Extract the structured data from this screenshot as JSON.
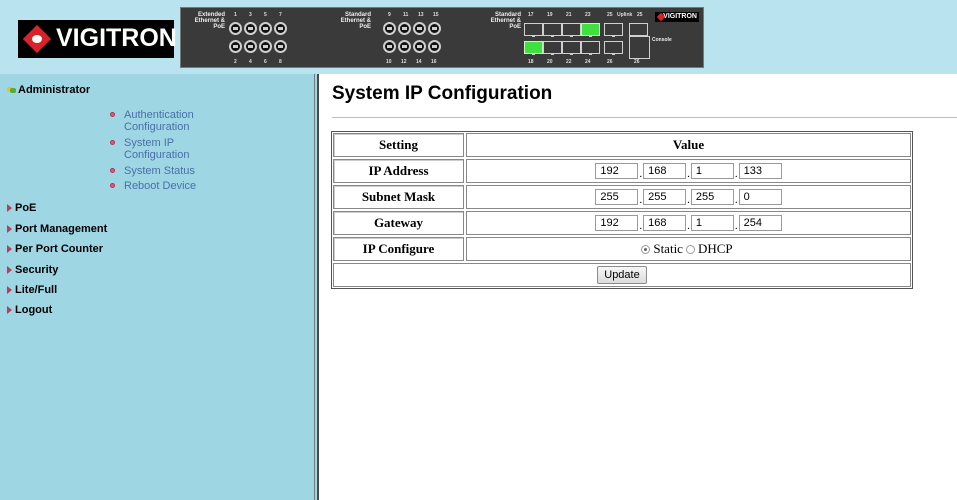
{
  "brand": {
    "logo_text": "VIGITRON",
    "mini_logo_text": "VIGITRON"
  },
  "device": {
    "groups": [
      {
        "label": "Extended Ethernet & PoE",
        "top_ports": [
          "1",
          "3",
          "5",
          "7"
        ],
        "bottom_ports": [
          "2",
          "4",
          "6",
          "8"
        ]
      },
      {
        "label": "Standard Ethernet & PoE",
        "top_ports": [
          "9",
          "11",
          "13",
          "15"
        ],
        "bottom_ports": [
          "10",
          "12",
          "14",
          "16"
        ]
      },
      {
        "label": "Standard Ethernet & PoE",
        "top_ports": [
          "17",
          "19",
          "21",
          "23"
        ],
        "bottom_ports": [
          "18",
          "20",
          "22",
          "24"
        ]
      }
    ],
    "uplink_label": "Uplink",
    "uplink_top": [
      "25",
      "25"
    ],
    "uplink_bottom": [
      "26",
      "26"
    ],
    "console_label": "Console",
    "active_ports": [
      "23",
      "18"
    ]
  },
  "sidebar": {
    "admin_label": "Administrator",
    "admin_items": [
      {
        "label": "Authentication Configuration",
        "lines": [
          "Authentication",
          "Configuration"
        ]
      },
      {
        "label": "System IP Configuration",
        "lines": [
          "System IP",
          "Configuration"
        ]
      },
      {
        "label": "System Status",
        "lines": [
          "System Status"
        ]
      },
      {
        "label": "Reboot Device",
        "lines": [
          "Reboot Device"
        ]
      }
    ],
    "sections": [
      "PoE",
      "Port Management",
      "Per Port Counter",
      "Security",
      "Lite/Full",
      "Logout"
    ]
  },
  "page": {
    "title": "System IP Configuration",
    "table": {
      "header_setting": "Setting",
      "header_value": "Value",
      "ip_address_label": "IP Address",
      "ip_address": [
        "192",
        "168",
        "1",
        "133"
      ],
      "subnet_mask_label": "Subnet Mask",
      "subnet_mask": [
        "255",
        "255",
        "255",
        "0"
      ],
      "gateway_label": "Gateway",
      "gateway": [
        "192",
        "168",
        "1",
        "254"
      ],
      "ip_configure_label": "IP Configure",
      "option_static": "Static",
      "option_dhcp": "DHCP",
      "selected_option": "Static",
      "update_label": "Update"
    }
  }
}
